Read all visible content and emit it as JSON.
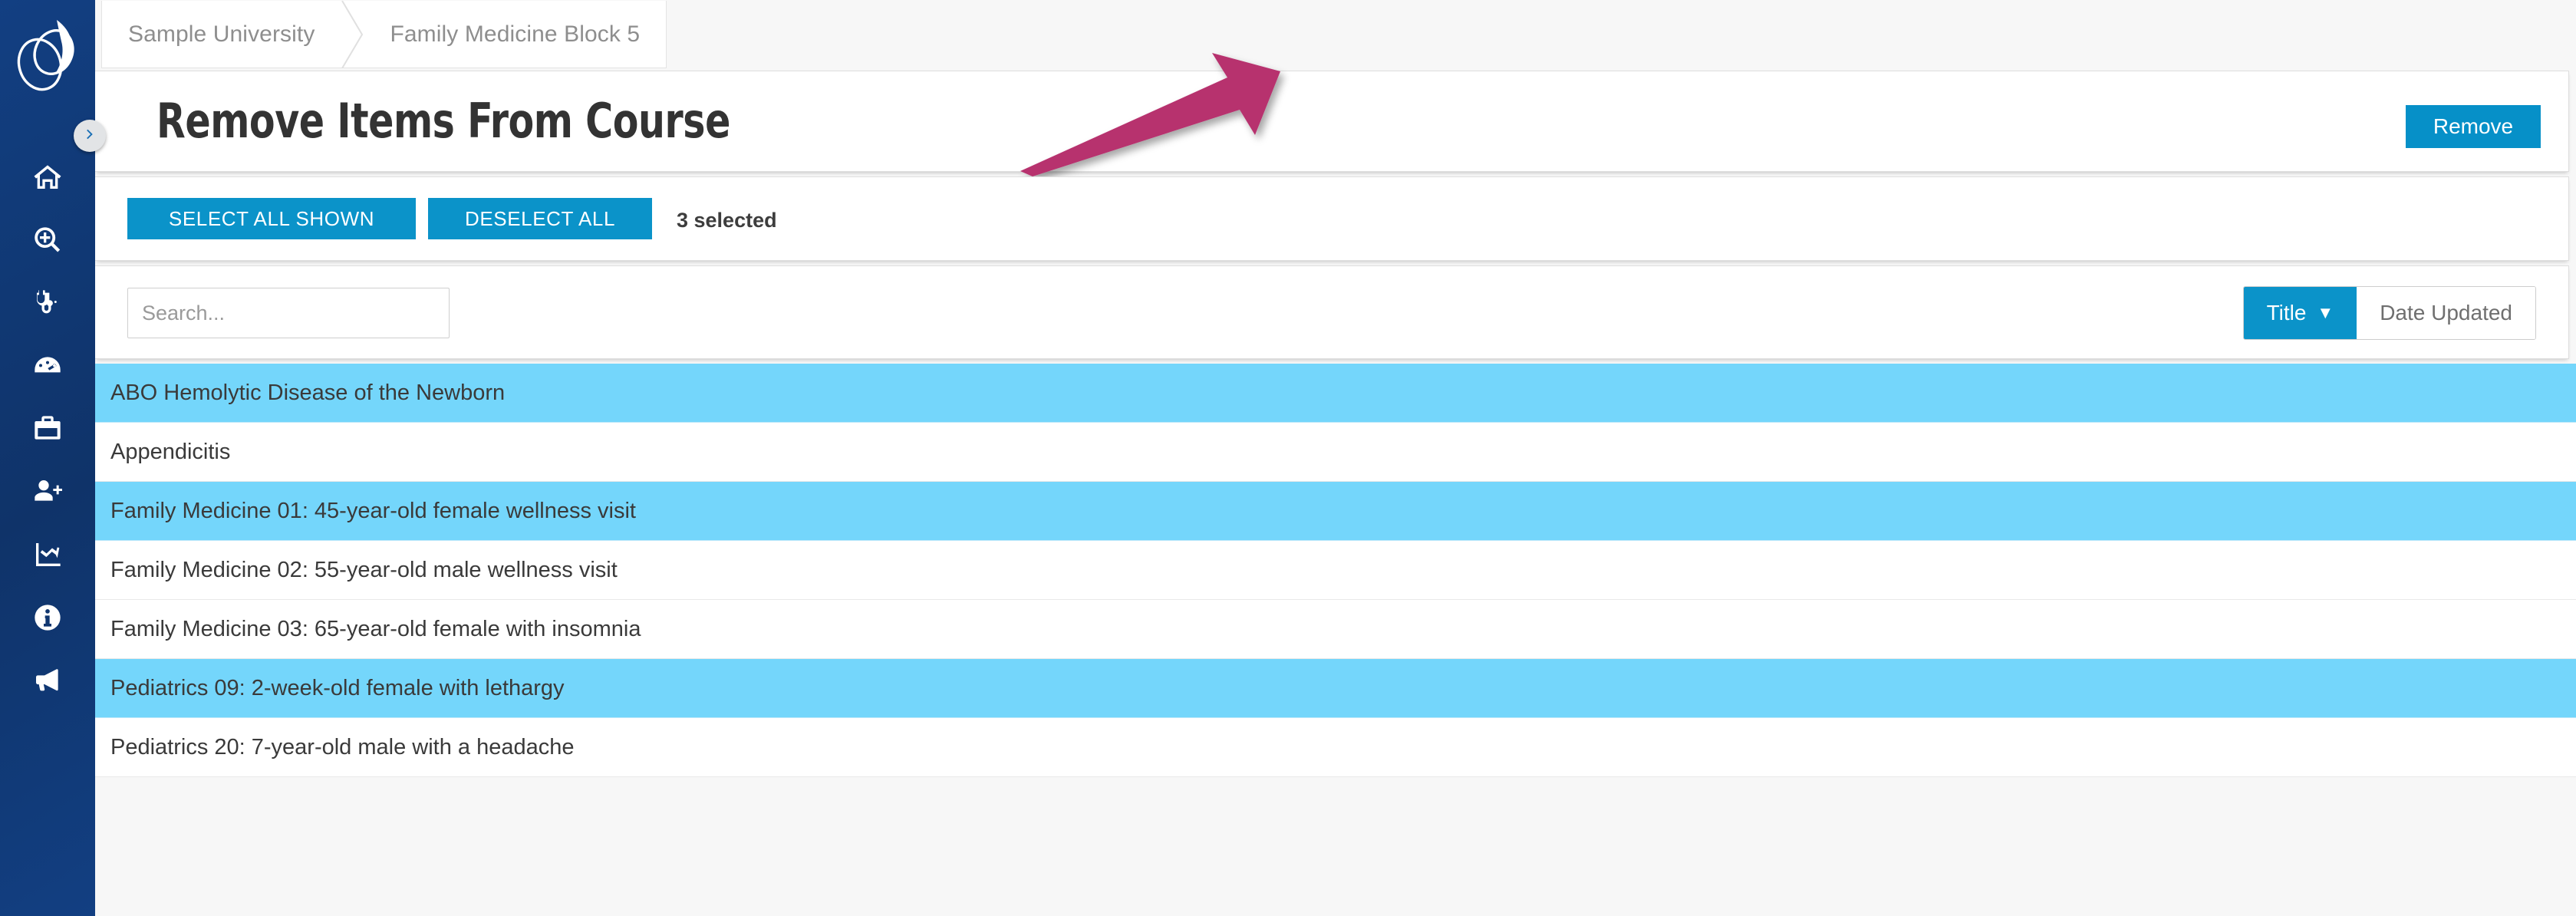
{
  "brand": {
    "sidebar_color": "#123f82",
    "accent_color": "#0b93c9",
    "selected_row_color": "#74d6fb",
    "annotation_arrow_color": "#b7306e"
  },
  "sidebar": {
    "logo_name": "aquifer-logo",
    "items": [
      {
        "icon": "home-icon",
        "name": "sidebar-item-home"
      },
      {
        "icon": "search-plus-icon",
        "name": "sidebar-item-search"
      },
      {
        "icon": "stethoscope-icon",
        "name": "sidebar-item-cases"
      },
      {
        "icon": "gauge-icon",
        "name": "sidebar-item-dashboard"
      },
      {
        "icon": "briefcase-medical-icon",
        "name": "sidebar-item-toolbox"
      },
      {
        "icon": "user-plus-icon",
        "name": "sidebar-item-add-user"
      },
      {
        "icon": "chart-line-icon",
        "name": "sidebar-item-reports"
      },
      {
        "icon": "info-circle-icon",
        "name": "sidebar-item-info"
      },
      {
        "icon": "megaphone-icon",
        "name": "sidebar-item-announcements"
      }
    ]
  },
  "breadcrumb": {
    "items": [
      {
        "label": "Sample University"
      },
      {
        "label": "Family Medicine Block 5"
      }
    ]
  },
  "header": {
    "title": "Remove Items From Course",
    "remove_label": "Remove"
  },
  "toolbar": {
    "select_all_shown_label": "SELECT ALL SHOWN",
    "deselect_all_label": "DESELECT ALL",
    "selected_count_text": "3 selected"
  },
  "filters": {
    "search_placeholder": "Search...",
    "search_value": "",
    "sort_options": [
      {
        "label": "Title",
        "active": true,
        "caret": "▼"
      },
      {
        "label": "Date Updated",
        "active": false,
        "caret": ""
      }
    ]
  },
  "list": {
    "rows": [
      {
        "label": "ABO Hemolytic Disease of the Newborn",
        "selected": true
      },
      {
        "label": "Appendicitis",
        "selected": false
      },
      {
        "label": "Family Medicine 01: 45-year-old female wellness visit",
        "selected": true
      },
      {
        "label": "Family Medicine 02: 55-year-old male wellness visit",
        "selected": false
      },
      {
        "label": "Family Medicine 03: 65-year-old female with insomnia",
        "selected": false
      },
      {
        "label": "Pediatrics 09: 2-week-old female with lethargy",
        "selected": true
      },
      {
        "label": "Pediatrics 20: 7-year-old male with a headache",
        "selected": false
      }
    ]
  },
  "annotation": {
    "type": "arrow",
    "points_to": "remove-button"
  }
}
